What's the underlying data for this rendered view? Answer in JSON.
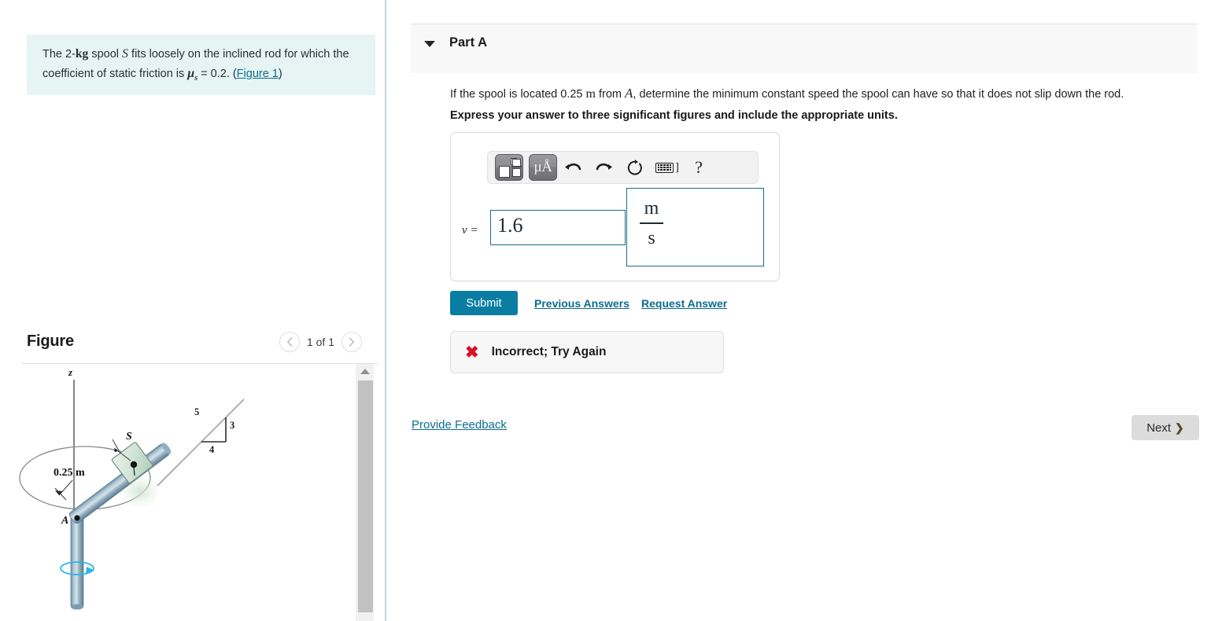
{
  "problem": {
    "text_prefix": "The 2-",
    "unit_kg": "kg",
    "text_mid1": " spool ",
    "symbol_S": "S",
    "text_mid2": " fits loosely on the inclined rod for which the coefficient of static friction is ",
    "mu_symbol": "μ",
    "mu_sub": "s",
    "mu_value": " = 0.2. (",
    "figure_link": "Figure 1",
    "text_close": ")"
  },
  "part": {
    "label": "Part A",
    "caret": "chevron-down-icon",
    "question_a": "If the spool is located 0.25 ",
    "question_unit": "m",
    "question_b": " from ",
    "question_symbol": "A",
    "question_c": ", determine the minimum constant speed the spool can have so that it does not slip down the rod.",
    "instruction": "Express your answer to three significant figures and include the appropriate units."
  },
  "toolbar": {
    "template_button": "math-template-icon",
    "units_button": "μÅ",
    "undo": "undo-icon",
    "redo": "redo-icon",
    "reset": "reset-icon",
    "keyboard": "keyboard-icon",
    "keyboard_bracket": "]",
    "help": "?"
  },
  "answer": {
    "variable_label": "v =",
    "value": "1.6",
    "unit_numerator": "m",
    "unit_denominator": "s"
  },
  "actions": {
    "submit": "Submit",
    "previous_answers": "Previous Answers",
    "request_answer": "Request Answer"
  },
  "feedback": {
    "icon": "x-mark-icon",
    "message": "Incorrect; Try Again"
  },
  "footer": {
    "provide_feedback": "Provide Feedback",
    "next": "Next",
    "next_chevron": "❯"
  },
  "figure": {
    "title": "Figure",
    "prev_icon": "chevron-left-icon",
    "next_icon": "chevron-right-icon",
    "counter": "1 of 1",
    "labels": {
      "axis_z": "z",
      "point_A": "A",
      "spool_S": "S",
      "distance": "0.25 m",
      "slope_hyp": "5",
      "slope_vert": "3",
      "slope_horiz": "4"
    }
  },
  "colors": {
    "accent": "#0a7ea2",
    "link": "#0b6d8f",
    "problem_bg": "#e6f4f3",
    "error": "#d8122a",
    "input_border": "#1a6f86",
    "divider": "#c8d4de"
  }
}
